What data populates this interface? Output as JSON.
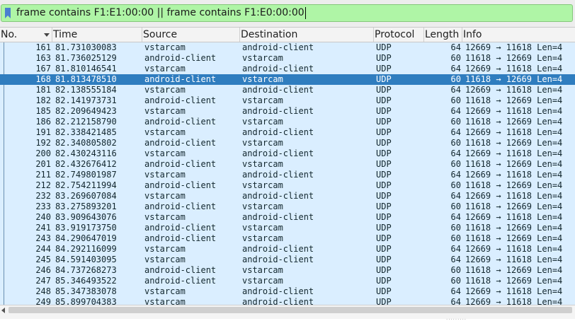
{
  "filter": {
    "value": "frame contains F1:E1:00:00 || frame contains F1:E0:00:00",
    "bookmark_icon": "bookmark-icon",
    "accent": "#aff5a6"
  },
  "columns": [
    "No.",
    "Time",
    "Source",
    "Destination",
    "Protocol",
    "Length",
    "Info"
  ],
  "colors": {
    "row_bg": "#daeeff",
    "selected_bg": "#2f7dbf"
  },
  "packets": [
    {
      "no": "161",
      "time": "81.731030083",
      "src": "vstarcam",
      "dst": "android-client",
      "proto": "UDP",
      "len": "64",
      "info": "12669 → 11618 Len=4"
    },
    {
      "no": "163",
      "time": "81.736025129",
      "src": "android-client",
      "dst": "vstarcam",
      "proto": "UDP",
      "len": "60",
      "info": "11618 → 12669 Len=4"
    },
    {
      "no": "167",
      "time": "81.810146541",
      "src": "vstarcam",
      "dst": "android-client",
      "proto": "UDP",
      "len": "64",
      "info": "12669 → 11618 Len=4"
    },
    {
      "no": "168",
      "time": "81.813478510",
      "src": "android-client",
      "dst": "vstarcam",
      "proto": "UDP",
      "len": "60",
      "info": "11618 → 12669 Len=4",
      "selected": true
    },
    {
      "no": "181",
      "time": "82.138555184",
      "src": "vstarcam",
      "dst": "android-client",
      "proto": "UDP",
      "len": "64",
      "info": "12669 → 11618 Len=4"
    },
    {
      "no": "182",
      "time": "82.141973731",
      "src": "android-client",
      "dst": "vstarcam",
      "proto": "UDP",
      "len": "60",
      "info": "11618 → 12669 Len=4"
    },
    {
      "no": "185",
      "time": "82.209649423",
      "src": "vstarcam",
      "dst": "android-client",
      "proto": "UDP",
      "len": "64",
      "info": "12669 → 11618 Len=4"
    },
    {
      "no": "186",
      "time": "82.212158790",
      "src": "android-client",
      "dst": "vstarcam",
      "proto": "UDP",
      "len": "60",
      "info": "11618 → 12669 Len=4"
    },
    {
      "no": "191",
      "time": "82.338421485",
      "src": "vstarcam",
      "dst": "android-client",
      "proto": "UDP",
      "len": "64",
      "info": "12669 → 11618 Len=4"
    },
    {
      "no": "192",
      "time": "82.340805802",
      "src": "android-client",
      "dst": "vstarcam",
      "proto": "UDP",
      "len": "60",
      "info": "11618 → 12669 Len=4"
    },
    {
      "no": "200",
      "time": "82.430243116",
      "src": "vstarcam",
      "dst": "android-client",
      "proto": "UDP",
      "len": "64",
      "info": "12669 → 11618 Len=4"
    },
    {
      "no": "201",
      "time": "82.432676412",
      "src": "android-client",
      "dst": "vstarcam",
      "proto": "UDP",
      "len": "60",
      "info": "11618 → 12669 Len=4"
    },
    {
      "no": "211",
      "time": "82.749801987",
      "src": "vstarcam",
      "dst": "android-client",
      "proto": "UDP",
      "len": "64",
      "info": "12669 → 11618 Len=4"
    },
    {
      "no": "212",
      "time": "82.754211994",
      "src": "android-client",
      "dst": "vstarcam",
      "proto": "UDP",
      "len": "60",
      "info": "11618 → 12669 Len=4"
    },
    {
      "no": "232",
      "time": "83.269607084",
      "src": "vstarcam",
      "dst": "android-client",
      "proto": "UDP",
      "len": "64",
      "info": "12669 → 11618 Len=4"
    },
    {
      "no": "233",
      "time": "83.275893201",
      "src": "android-client",
      "dst": "vstarcam",
      "proto": "UDP",
      "len": "60",
      "info": "11618 → 12669 Len=4"
    },
    {
      "no": "240",
      "time": "83.909643076",
      "src": "vstarcam",
      "dst": "android-client",
      "proto": "UDP",
      "len": "64",
      "info": "12669 → 11618 Len=4"
    },
    {
      "no": "241",
      "time": "83.919173750",
      "src": "android-client",
      "dst": "vstarcam",
      "proto": "UDP",
      "len": "60",
      "info": "11618 → 12669 Len=4"
    },
    {
      "no": "243",
      "time": "84.290647019",
      "src": "android-client",
      "dst": "vstarcam",
      "proto": "UDP",
      "len": "60",
      "info": "11618 → 12669 Len=4"
    },
    {
      "no": "244",
      "time": "84.292116099",
      "src": "vstarcam",
      "dst": "android-client",
      "proto": "UDP",
      "len": "64",
      "info": "12669 → 11618 Len=4"
    },
    {
      "no": "245",
      "time": "84.591403095",
      "src": "vstarcam",
      "dst": "android-client",
      "proto": "UDP",
      "len": "64",
      "info": "12669 → 11618 Len=4"
    },
    {
      "no": "246",
      "time": "84.737268273",
      "src": "android-client",
      "dst": "vstarcam",
      "proto": "UDP",
      "len": "60",
      "info": "11618 → 12669 Len=4"
    },
    {
      "no": "247",
      "time": "85.346493522",
      "src": "android-client",
      "dst": "vstarcam",
      "proto": "UDP",
      "len": "60",
      "info": "11618 → 12669 Len=4"
    },
    {
      "no": "248",
      "time": "85.347383078",
      "src": "vstarcam",
      "dst": "android-client",
      "proto": "UDP",
      "len": "64",
      "info": "12669 → 11618 Len=4"
    },
    {
      "no": "249",
      "time": "85.899704383",
      "src": "vstarcam",
      "dst": "android-client",
      "proto": "UDP",
      "len": "64",
      "info": "12669 → 11618 Len=4"
    }
  ]
}
